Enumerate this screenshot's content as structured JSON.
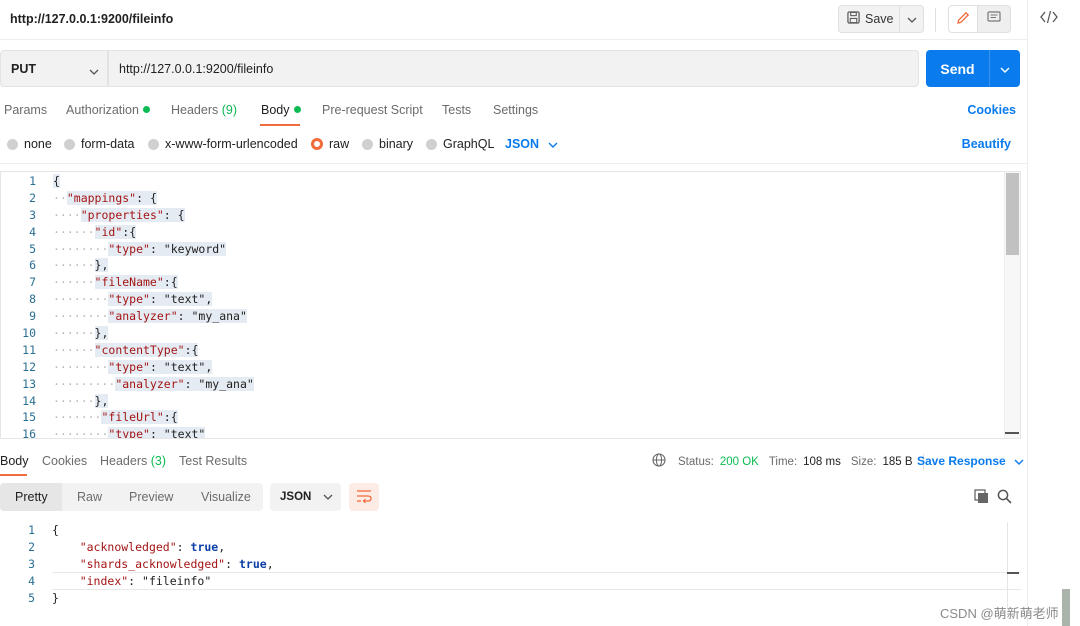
{
  "request": {
    "title": "http://127.0.0.1:9200/fileinfo",
    "method": "PUT",
    "url": "http://127.0.0.1:9200/fileinfo",
    "send_label": "Send",
    "save_label": "Save"
  },
  "req_tabs": {
    "params": "Params",
    "authorization": "Authorization",
    "headers": "Headers",
    "headers_count": "(9)",
    "body": "Body",
    "prerequest": "Pre-request Script",
    "tests": "Tests",
    "settings": "Settings",
    "cookies": "Cookies"
  },
  "body_types": {
    "none": "none",
    "form_data": "form-data",
    "urlencoded": "x-www-form-urlencoded",
    "raw": "raw",
    "binary": "binary",
    "graphql": "GraphQL",
    "format": "JSON",
    "beautify": "Beautify",
    "selected": "raw"
  },
  "editor": {
    "line_numbers": [
      "1",
      "2",
      "3",
      "4",
      "5",
      "6",
      "7",
      "8",
      "9",
      "10",
      "11",
      "12",
      "13",
      "14",
      "15",
      "16"
    ],
    "lines": [
      "{",
      "  \"mappings\": {",
      "    \"properties\": {",
      "      \"id\":{",
      "        \"type\": \"keyword\"",
      "      },",
      "      \"fileName\":{",
      "        \"type\": \"text\",",
      "        \"analyzer\": \"my_ana\"",
      "      },",
      "      \"contentType\":{",
      "        \"type\": \"text\",",
      "         \"analyzer\": \"my_ana\"",
      "      },",
      "       \"fileUrl\":{",
      "        \"type\": \"text\""
    ]
  },
  "response": {
    "tabs": {
      "body": "Body",
      "cookies": "Cookies",
      "headers": "Headers",
      "headers_count": "(3)",
      "test_results": "Test Results"
    },
    "status_label": "Status:",
    "status_value": "200 OK",
    "time_label": "Time:",
    "time_value": "108 ms",
    "size_label": "Size:",
    "size_value": "185 B",
    "save_response": "Save Response",
    "views": {
      "pretty": "Pretty",
      "raw": "Raw",
      "preview": "Preview",
      "visualize": "Visualize"
    },
    "format": "JSON",
    "line_numbers": [
      "1",
      "2",
      "3",
      "4",
      "5"
    ],
    "lines": [
      "{",
      "    \"acknowledged\": true,",
      "    \"shards_acknowledged\": true,",
      "    \"index\": \"fileinfo\"",
      "}"
    ]
  },
  "watermark": "CSDN @萌新萌老师",
  "colors": {
    "accent_blue": "#097bed",
    "accent_orange": "#f26b3a",
    "success_green": "#0cbb52"
  },
  "icons": [
    "save-icon",
    "chevron-down-icon",
    "pencil-icon",
    "comment-icon",
    "code-icon",
    "globe-icon",
    "wrap-icon",
    "copy-icon",
    "search-icon"
  ]
}
